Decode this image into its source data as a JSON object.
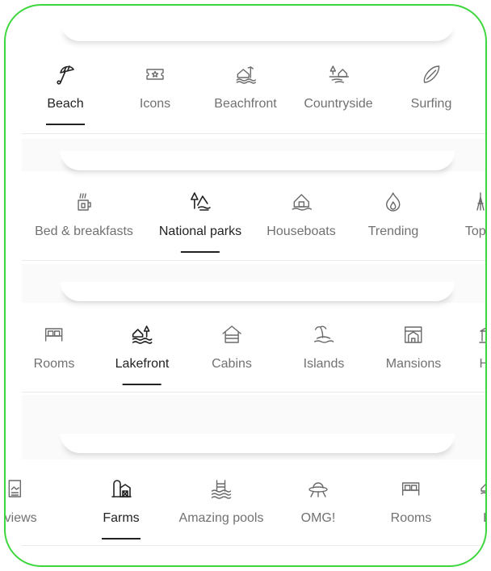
{
  "rows": [
    {
      "items": [
        {
          "label": "Beach",
          "icon": "beach-umbrella-icon",
          "selected": true
        },
        {
          "label": "Icons",
          "icon": "ticket-star-icon",
          "selected": false
        },
        {
          "label": "Beachfront",
          "icon": "beachfront-house-icon",
          "selected": false
        },
        {
          "label": "Countryside",
          "icon": "countryside-icon",
          "selected": false
        },
        {
          "label": "Surfing",
          "icon": "surfboard-icon",
          "selected": false
        }
      ]
    },
    {
      "items": [
        {
          "label": "Bed & breakfasts",
          "icon": "coffee-mug-icon",
          "selected": false
        },
        {
          "label": "National parks",
          "icon": "national-park-icon",
          "selected": true
        },
        {
          "label": "Houseboats",
          "icon": "houseboat-icon",
          "selected": false
        },
        {
          "label": "Trending",
          "icon": "flame-icon",
          "selected": false
        },
        {
          "label": "Top c",
          "icon": "tower-icon",
          "selected": false
        }
      ]
    },
    {
      "items": [
        {
          "label": "Rooms",
          "icon": "bed-icon",
          "selected": false
        },
        {
          "label": "Lakefront",
          "icon": "lakefront-icon",
          "selected": true
        },
        {
          "label": "Cabins",
          "icon": "cabin-icon",
          "selected": false
        },
        {
          "label": "Islands",
          "icon": "island-icon",
          "selected": false
        },
        {
          "label": "Mansions",
          "icon": "mansion-icon",
          "selected": false
        },
        {
          "label": "His",
          "icon": "historical-icon",
          "selected": false
        }
      ]
    },
    {
      "items": [
        {
          "label": "g views",
          "icon": "view-icon",
          "selected": false
        },
        {
          "label": "Farms",
          "icon": "farm-icon",
          "selected": true
        },
        {
          "label": "Amazing pools",
          "icon": "pool-icon",
          "selected": false
        },
        {
          "label": "OMG!",
          "icon": "ufo-icon",
          "selected": false
        },
        {
          "label": "Rooms",
          "icon": "bed-icon",
          "selected": false
        },
        {
          "label": "La",
          "icon": "lakefront-icon",
          "selected": false
        }
      ]
    }
  ]
}
